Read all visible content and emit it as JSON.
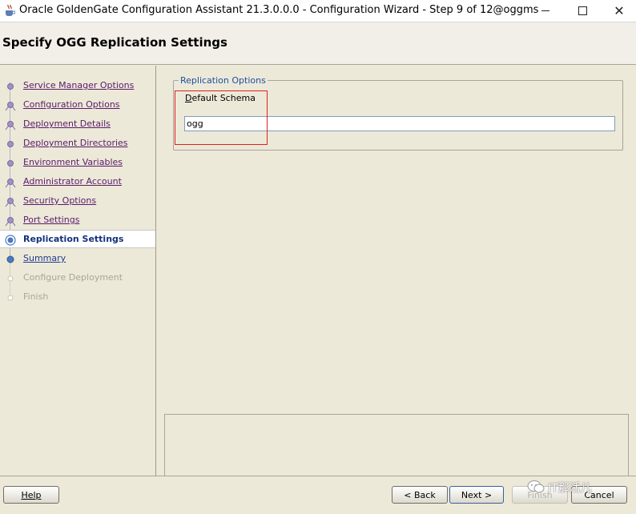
{
  "window": {
    "title": "Oracle GoldenGate Configuration Assistant 21.3.0.0.0 - Configuration Wizard - Step 9 of 12@oggms",
    "close_glyph": "✕"
  },
  "header": {
    "title": "Specify OGG Replication Settings"
  },
  "nav": {
    "steps": [
      {
        "label": "Service Manager Options",
        "state": "done"
      },
      {
        "label": "Configuration Options",
        "state": "done"
      },
      {
        "label": "Deployment Details",
        "state": "done"
      },
      {
        "label": "Deployment Directories",
        "state": "done"
      },
      {
        "label": "Environment Variables",
        "state": "done"
      },
      {
        "label": "Administrator Account",
        "state": "done"
      },
      {
        "label": "Security Options",
        "state": "done"
      },
      {
        "label": "Port Settings",
        "state": "done"
      },
      {
        "label": "Replication Settings",
        "state": "current"
      },
      {
        "label": "Summary",
        "state": "next"
      },
      {
        "label": "Configure Deployment",
        "state": "disabled"
      },
      {
        "label": "Finish",
        "state": "disabled"
      }
    ]
  },
  "replication": {
    "group_title": "Replication Options",
    "schema_label": "Default Schema",
    "schema_value": "ogg"
  },
  "buttons": {
    "help": "Help",
    "back": "< Back",
    "next": "Next >",
    "finish": "Finish",
    "cancel": "Cancel"
  },
  "watermark": {
    "text": "IT那活儿"
  },
  "colors": {
    "highlight_box": "#e02020",
    "current_step": "#12327a",
    "visited_link": "#5a1b6b",
    "legend": "#1f4e9c"
  }
}
